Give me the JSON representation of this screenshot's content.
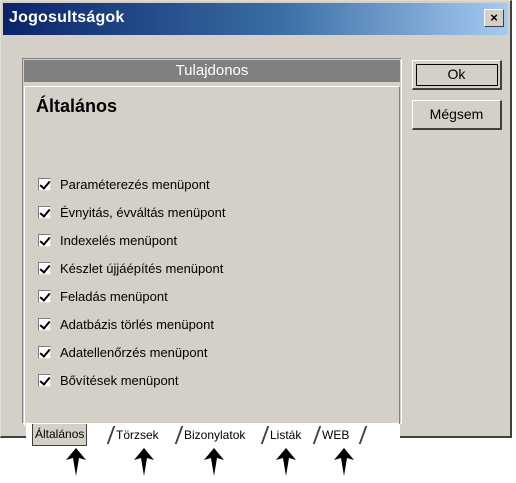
{
  "window": {
    "title": "Jogosultságok",
    "close_glyph": "×"
  },
  "owner_header": "Tulajdonos",
  "section_title": "Általános",
  "permissions": [
    {
      "label": "Paraméterezés menüpont",
      "checked": true
    },
    {
      "label": "Évnyitás, évváltás menüpont",
      "checked": true
    },
    {
      "label": "Indexelés menüpont",
      "checked": true
    },
    {
      "label": "Készlet újjáépítés menüpont",
      "checked": true
    },
    {
      "label": "Feladás menüpont",
      "checked": true
    },
    {
      "label": "Adatbázis törlés menüpont",
      "checked": true
    },
    {
      "label": "Adatellenőrzés menüpont",
      "checked": true
    },
    {
      "label": "Bővítések menüpont",
      "checked": true
    }
  ],
  "tabs": [
    "Általános",
    "Törzsek",
    "Bizonylatok",
    "Listák",
    "WEB"
  ],
  "buttons": {
    "ok": "Ok",
    "cancel": "Mégsem"
  },
  "colors": {
    "title_start": "#0a246a",
    "title_end": "#a6caf0",
    "face": "#d4d0c8",
    "header_bg": "#808080"
  }
}
